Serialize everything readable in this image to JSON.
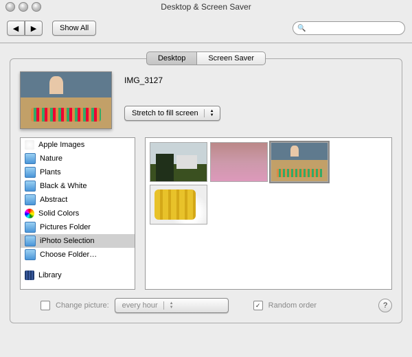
{
  "window": {
    "title": "Desktop & Screen Saver"
  },
  "toolbar": {
    "show_all": "Show All",
    "search_placeholder": ""
  },
  "tabs": {
    "desktop": "Desktop",
    "screensaver": "Screen Saver",
    "active": "desktop"
  },
  "current_image": {
    "name": "IMG_3127"
  },
  "fit_mode": {
    "selected": "Stretch to fill screen"
  },
  "sources": [
    {
      "label": "Apple Images",
      "icon": "apple"
    },
    {
      "label": "Nature",
      "icon": "folder"
    },
    {
      "label": "Plants",
      "icon": "folder"
    },
    {
      "label": "Black & White",
      "icon": "folder"
    },
    {
      "label": "Abstract",
      "icon": "folder"
    },
    {
      "label": "Solid Colors",
      "icon": "colors"
    },
    {
      "label": "Pictures Folder",
      "icon": "folder"
    },
    {
      "label": "iPhoto Selection",
      "icon": "folder",
      "selected": true
    },
    {
      "label": "Choose Folder…",
      "icon": "folder"
    },
    {
      "label": "Library",
      "icon": "library",
      "gap": true
    }
  ],
  "thumbs_count": 4,
  "thumb_selected_index": 2,
  "change_picture": {
    "label": "Change picture:",
    "checked": false,
    "interval": "every hour"
  },
  "random_order": {
    "label": "Random order",
    "checked": true
  },
  "help": "?"
}
